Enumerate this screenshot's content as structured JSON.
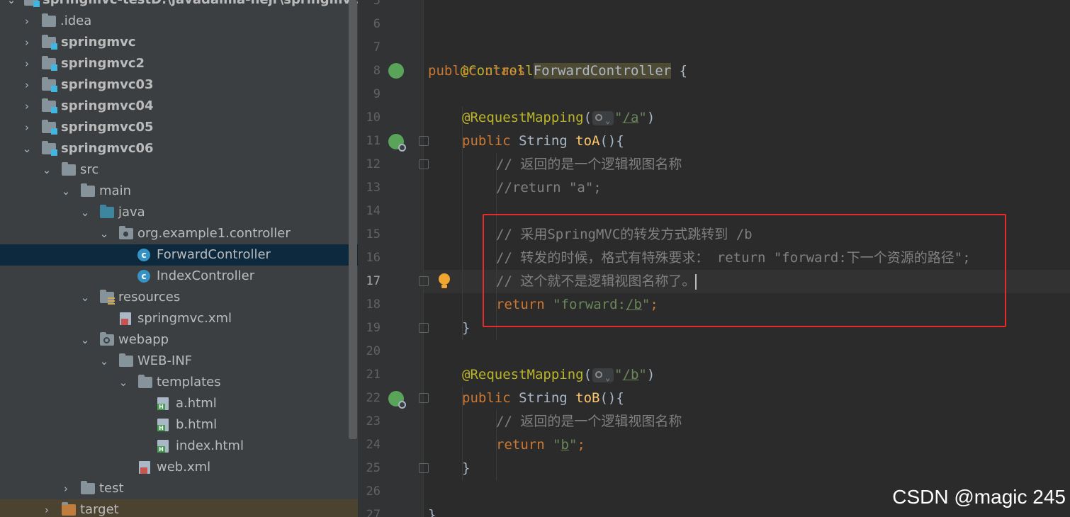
{
  "project": {
    "root_label": "springmvc-test",
    "root_path": "D:\\javadaima-nejr\\springmvc-test",
    "items": [
      {
        "label": ".idea"
      },
      {
        "label": "springmvc"
      },
      {
        "label": "springmvc2"
      },
      {
        "label": "springmvc03"
      },
      {
        "label": "springmvc04"
      },
      {
        "label": "springmvc05"
      },
      {
        "label": "springmvc06"
      },
      {
        "label": "src"
      },
      {
        "label": "main"
      },
      {
        "label": "java"
      },
      {
        "label": "org.example1.controller"
      },
      {
        "label": "ForwardController"
      },
      {
        "label": "IndexController"
      },
      {
        "label": "resources"
      },
      {
        "label": "springmvc.xml"
      },
      {
        "label": "webapp"
      },
      {
        "label": "WEB-INF"
      },
      {
        "label": "templates"
      },
      {
        "label": "a.html"
      },
      {
        "label": "b.html"
      },
      {
        "label": "index.html"
      },
      {
        "label": "web.xml"
      },
      {
        "label": "test"
      },
      {
        "label": "target"
      }
    ]
  },
  "editor": {
    "line_numbers": [
      "5",
      "6",
      "7",
      "8",
      "9",
      "10",
      "11",
      "12",
      "13",
      "14",
      "15",
      "16",
      "17",
      "18",
      "19",
      "20",
      "21",
      "22",
      "23",
      "24",
      "25",
      "26",
      "27"
    ],
    "current_line": "17",
    "code": {
      "l7_ann": "@Controller",
      "l8_kw": "public class",
      "l8_cls": "ForwardController",
      "l8_end": " {",
      "l10_ann": "@RequestMapping",
      "l10_open": "(",
      "l10_str_q1": "\"",
      "l10_str_path": "/a",
      "l10_str_q2": "\"",
      "l10_close": ")",
      "l11_kw": "public",
      "l11_type": " String ",
      "l11_fn": "toA",
      "l11_end": "(){",
      "l12": "// 返回的是一个逻辑视图名称",
      "l13": "//return \"a\";",
      "l15": "// 采用SpringMVC的转发方式跳转到 /b",
      "l16": "// 转发的时候，格式有特殊要求： return \"forward:下一个资源的路径\";",
      "l17": "// 这个就不是逻辑视图名称了。",
      "l18_kw": "return",
      "l18_str_a": " \"forward:",
      "l18_str_path": "/b",
      "l18_str_b": "\"",
      "l18_end": ";",
      "l19": "}",
      "l21_ann": "@RequestMapping",
      "l21_open": "(",
      "l21_str_q1": "\"",
      "l21_str_path": "/b",
      "l21_str_q2": "\"",
      "l21_close": ")",
      "l22_kw": "public",
      "l22_type": " String ",
      "l22_fn": "toB",
      "l22_end": "(){",
      "l23": "// 返回的是一个逻辑视图名称",
      "l24_kw": "return",
      "l24_str_a": " \"",
      "l24_str_b": "b",
      "l24_str_c": "\"",
      "l24_end": ";",
      "l25": "}",
      "l27": "}"
    }
  },
  "watermark": "CSDN @magic 245",
  "colors": {
    "keyword": "#cc7832",
    "annotation": "#bbb529",
    "string": "#6a8759",
    "comment": "#808080",
    "function": "#ffc66d",
    "highlight_box": "#e52b2b"
  }
}
